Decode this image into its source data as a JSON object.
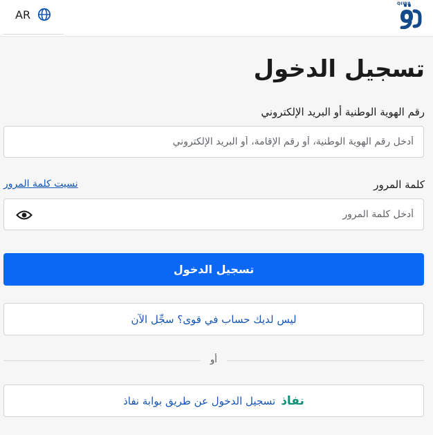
{
  "header": {
    "language_label": "AR",
    "logo_text": "QIWA"
  },
  "login": {
    "title": "تسجيل الدخول",
    "id_label": "رقم الهوية الوطنية أو البريد الإلكتروني",
    "id_placeholder": "أدخل رقم الهوية الوطنية، أو رقم الإقامة، أو البريد الإلكتروني",
    "password_label": "كلمة المرور",
    "forgot_password": "نسيت كلمة المرور",
    "password_placeholder": "أدخل كلمة المرور",
    "submit_label": "تسجيل الدخول",
    "register_label": "ليس لديك حساب في قوى؟ سجِّل الآن",
    "or_label": "أو",
    "nafath_brand": "نفاذ",
    "nafath_label": "تسجيل الدخول عن طريق بوابة نفاذ"
  },
  "colors": {
    "primary": "#0a68f5",
    "link": "#1556b3",
    "nafath": "#13907a",
    "background": "#f6f6f7"
  },
  "icons": {
    "language": "globe-icon",
    "password_toggle": "eye-icon"
  }
}
